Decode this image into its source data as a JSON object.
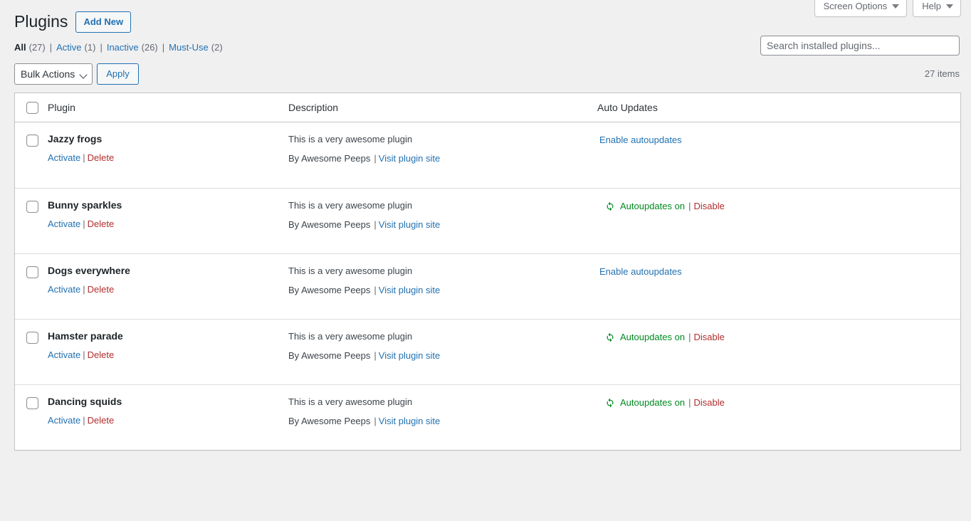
{
  "screen_meta": {
    "screen_options_label": "Screen Options",
    "help_label": "Help"
  },
  "header": {
    "title": "Plugins",
    "add_new_label": "Add New"
  },
  "search": {
    "placeholder": "Search installed plugins...",
    "value": ""
  },
  "filters": [
    {
      "label": "All",
      "count": "(27)",
      "current": true
    },
    {
      "label": "Active",
      "count": "(1)",
      "current": false
    },
    {
      "label": "Inactive",
      "count": "(26)",
      "current": false
    },
    {
      "label": "Must-Use",
      "count": "(2)",
      "current": false
    }
  ],
  "filter_separator": "|",
  "tablenav": {
    "bulk_actions_label": "Bulk Actions",
    "apply_label": "Apply",
    "displaying_num": "27 items"
  },
  "table": {
    "columns": {
      "plugin": "Plugin",
      "description": "Description",
      "auto_updates": "Auto Updates"
    },
    "actions": {
      "activate": "Activate",
      "delete": "Delete",
      "separator": "|"
    },
    "meta": {
      "author_prefix": "By Awesome Peeps",
      "visit_site": "Visit plugin site",
      "separator": "|"
    },
    "autoupdates": {
      "enable_label": "Enable autoupdates",
      "on_label": "Autoupdates on",
      "disable_label": "Disable",
      "separator": "|",
      "icon": "update-sync-icon",
      "on_color": "#008a20"
    },
    "rows": [
      {
        "name": "Jazzy frogs",
        "description": "This is a very awesome plugin",
        "autoupdate_state": "off"
      },
      {
        "name": "Bunny sparkles",
        "description": "This is a very awesome plugin",
        "autoupdate_state": "on"
      },
      {
        "name": "Dogs everywhere",
        "description": "This is a very awesome plugin",
        "autoupdate_state": "off"
      },
      {
        "name": "Hamster parade",
        "description": "This is a very awesome plugin",
        "autoupdate_state": "on"
      },
      {
        "name": "Dancing squids",
        "description": "This is a very awesome plugin",
        "autoupdate_state": "on"
      }
    ]
  },
  "colors": {
    "link": "#2271b1",
    "danger": "#b32d2e",
    "success": "#008a20",
    "page_bg": "#f0f0f1"
  }
}
